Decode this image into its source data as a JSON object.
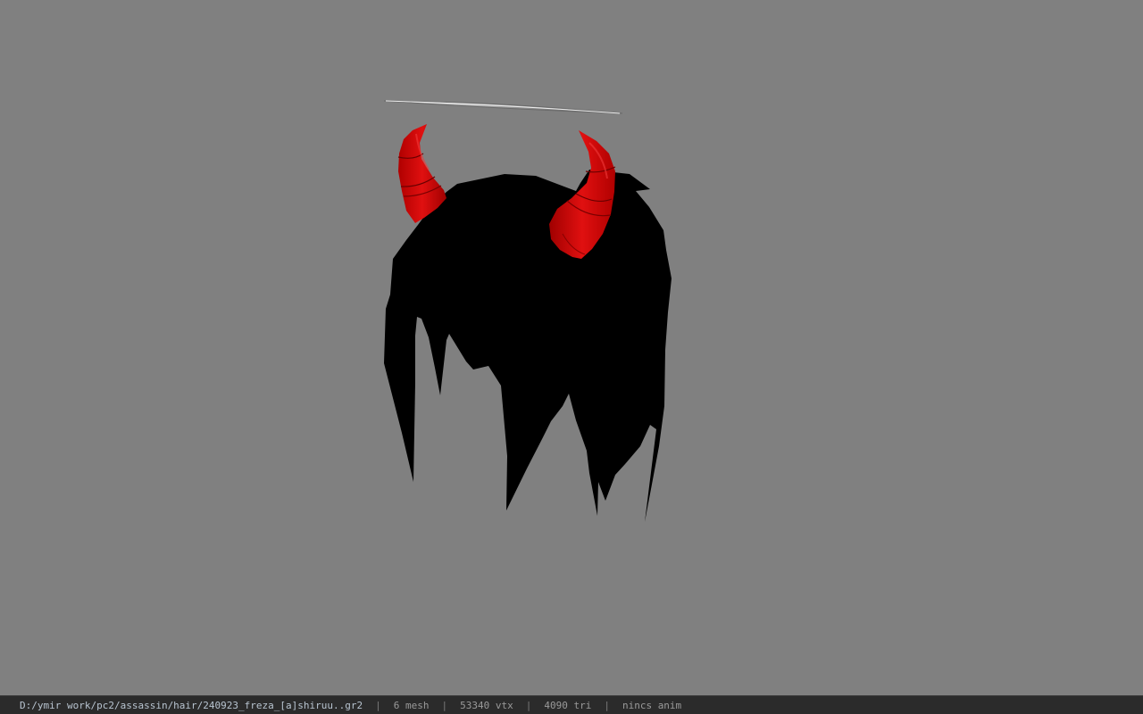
{
  "viewport": {
    "background_color": "#808080",
    "model": {
      "hair_color": "#000000",
      "horn_color": "#d40000",
      "halo_color": "#c8c8c8"
    }
  },
  "statusbar": {
    "file_path": "D:/ymir work/pc2/assassin/hair/240923_freza_[a]shiruu..gr2",
    "mesh_count": "6 mesh",
    "vertex_count": "53340 vtx",
    "triangle_count": "4090 tri",
    "anim_status": "nincs anim",
    "separator": "|"
  }
}
